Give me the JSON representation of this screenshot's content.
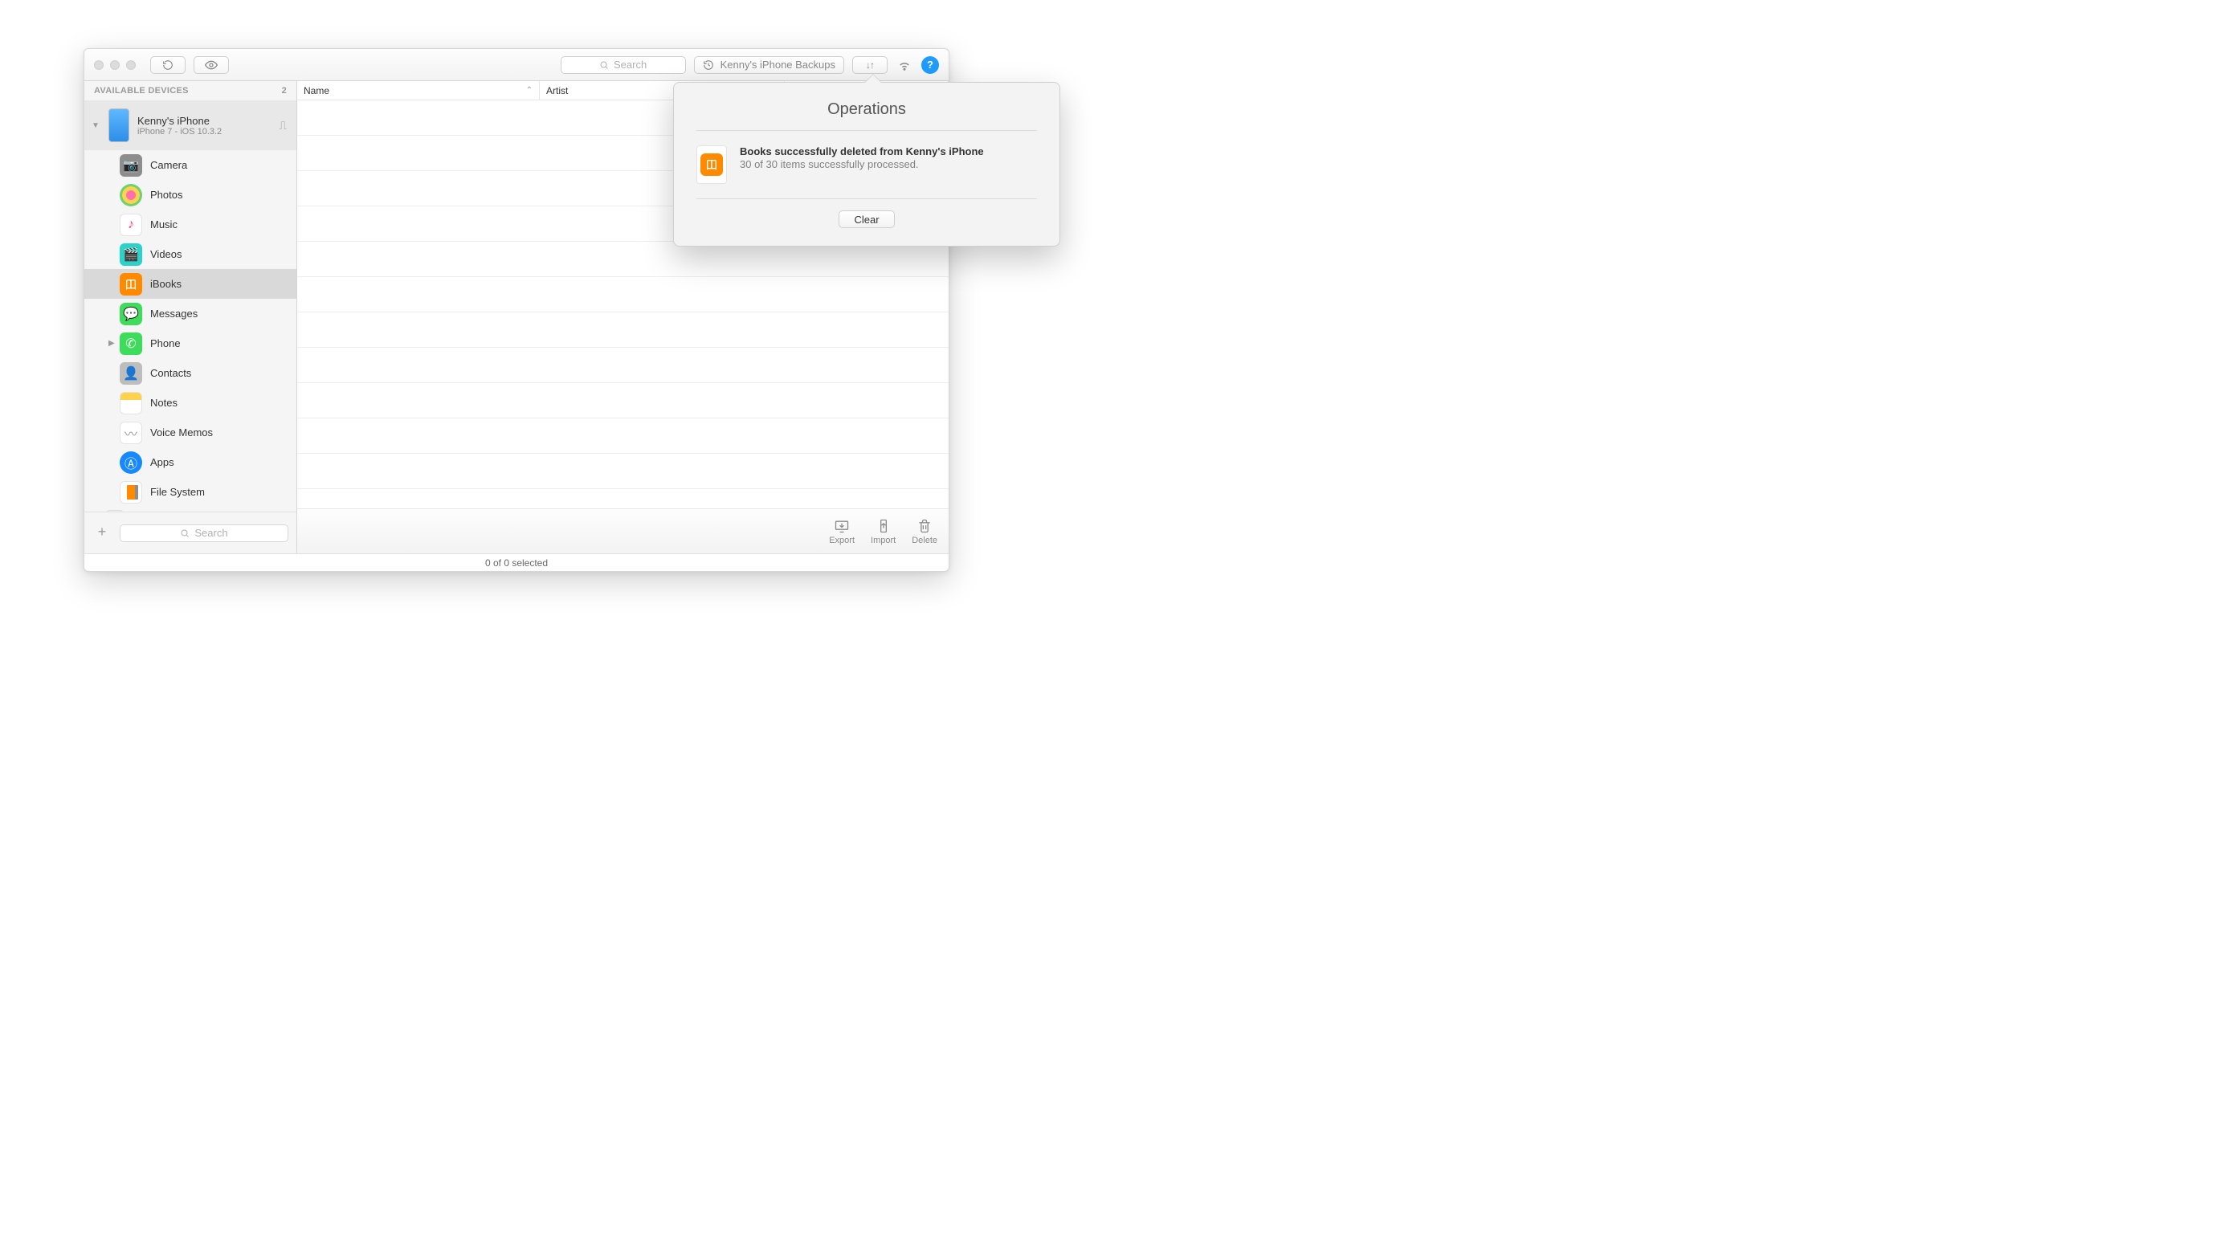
{
  "toolbar": {
    "search_placeholder": "Search",
    "backups_label": "Kenny's iPhone Backups",
    "help_label": "?"
  },
  "sidebar": {
    "header": "AVAILABLE DEVICES",
    "device_count": "2",
    "device": {
      "name": "Kenny's iPhone",
      "sub": "iPhone 7 - iOS 10.3.2"
    },
    "items": [
      {
        "label": "Camera"
      },
      {
        "label": "Photos"
      },
      {
        "label": "Music"
      },
      {
        "label": "Videos"
      },
      {
        "label": "iBooks"
      },
      {
        "label": "Messages"
      },
      {
        "label": "Phone"
      },
      {
        "label": "Contacts"
      },
      {
        "label": "Notes"
      },
      {
        "label": "Voice Memos"
      },
      {
        "label": "Apps"
      },
      {
        "label": "File System"
      }
    ],
    "search_placeholder": "Search"
  },
  "columns": {
    "name": "Name",
    "artist": "Artist"
  },
  "actions": {
    "export": "Export",
    "import": "Import",
    "delete": "Delete"
  },
  "status": "0 of 0 selected",
  "popover": {
    "title": "Operations",
    "op_title": "Books successfully deleted from Kenny's iPhone",
    "op_sub": "30 of 30 items successfully processed.",
    "clear": "Clear"
  }
}
